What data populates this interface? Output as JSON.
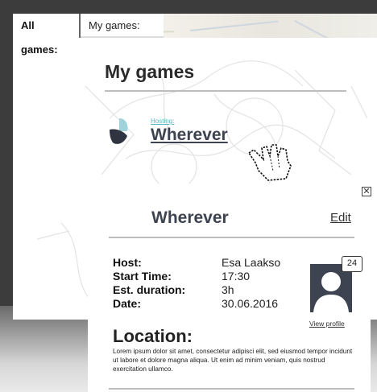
{
  "tabs": {
    "all_label": "All games:",
    "my_label": "My games:"
  },
  "page": {
    "title": "My games"
  },
  "hosted_game": {
    "hosting_label": "Hosting:",
    "name": "Wherever"
  },
  "details": {
    "name": "Wherever",
    "edit_label": "Edit",
    "close_glyph": "✕",
    "rows": [
      {
        "label": "Host:",
        "value": "Esa Laakso"
      },
      {
        "label": "Start Time:",
        "value": "17:30"
      },
      {
        "label": "Est. duration:",
        "value": "3h"
      },
      {
        "label": "Date:",
        "value": "30.06.2016"
      }
    ],
    "badge_count": "24",
    "view_profile_label": "View profile",
    "location_title": "Location:",
    "location_text": "Lorem ipsum dolor sit amet, consectetur adipisci elit, sed eiusmod tempor incidunt ut labore et dolore magna aliqua. Ut enim ad minim veniam, quis nostrud exercitation ullamco."
  },
  "colors": {
    "bezel": "#3c3c3c",
    "accent": "#58b6c1",
    "title": "#3d4350",
    "logo_light": "#9fd3db",
    "logo_dark": "#2f3440"
  },
  "icons": {
    "logo": "wherever-logo-icon",
    "cursor": "hand-pointer-icon",
    "close": "close-icon",
    "avatar": "user-avatar-icon"
  }
}
